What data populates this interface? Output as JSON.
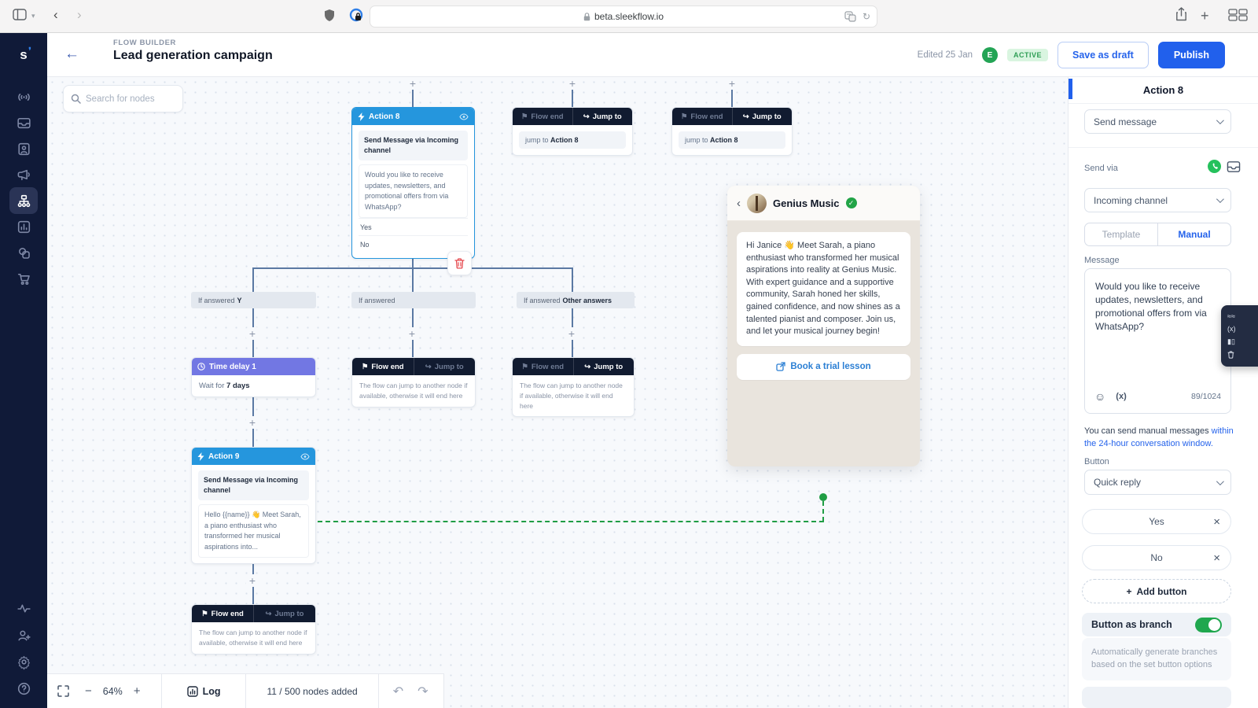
{
  "browser": {
    "url": "beta.sleekflow.io"
  },
  "header": {
    "eyebrow": "FLOW BUILDER",
    "title": "Lead generation campaign",
    "edited": "Edited 25 Jan",
    "avatar": "E",
    "status": "ACTIVE",
    "save_draft": "Save as draft",
    "publish": "Publish"
  },
  "sidebar": {
    "logo": "s",
    "icons": [
      "broadcast-icon",
      "inbox-icon",
      "contacts-icon",
      "campaigns-icon",
      "flow-builder-icon",
      "analytics-icon",
      "integrations-icon",
      "commerce-icon",
      "activity-icon",
      "invite-user-icon",
      "settings-icon",
      "help-icon"
    ]
  },
  "canvas": {
    "search_placeholder": "Search for nodes",
    "labels": {
      "flow_end": "Flow end",
      "jump_to": "Jump to",
      "end_body": "The flow can jump to another node if available, otherwise it will end here"
    },
    "action8": {
      "title": "Action 8",
      "subtitle": "Send Message via Incoming channel",
      "message": "Would you like to receive updates, newsletters, and promotional offers from via WhatsApp?",
      "option_yes": "Yes",
      "option_no": "No"
    },
    "jump_node": {
      "body_prefix": "jump to ",
      "body_target": "Action 8"
    },
    "branches": {
      "b1_prefix": "If answered",
      "b1_value": "Y",
      "b2_prefix": "If answered",
      "b3_prefix": "If answered",
      "b3_value": "Other answers"
    },
    "time_delay": {
      "title": "Time delay 1",
      "body_prefix": "Wait for ",
      "body_value": "7 days"
    },
    "action9": {
      "title": "Action 9",
      "subtitle": "Send Message via Incoming channel",
      "message": "Hello {{name}} 👋 Meet Sarah, a piano enthusiast who transformed her musical aspirations into..."
    },
    "preview": {
      "name": "Genius Music",
      "message": "Hi Janice 👋 Meet Sarah, a piano enthusiast who transformed her musical aspirations into reality at Genius Music. With expert guidance and a supportive community, Sarah honed her skills, gained confidence, and now shines as a talented pianist and composer. Join us, and let your musical journey begin!",
      "button": "Book a trial lesson"
    },
    "toolbar": {
      "zoom": "64%",
      "log": "Log",
      "count": "11 / 500 nodes added"
    }
  },
  "panel": {
    "title": "Action 8",
    "action_select": "Send message",
    "send_via_label": "Send via",
    "channel_select": "Incoming channel",
    "tab_template": "Template",
    "tab_manual": "Manual",
    "message_label": "Message",
    "message_value": "Would you like to receive updates, newsletters, and promotional offers from via WhatsApp?",
    "counter": "89/1024",
    "note_text": "You can send manual messages ",
    "note_link": "within the 24-hour conversation window.",
    "button_label": "Button",
    "button_type_select": "Quick reply",
    "btn_yes": "Yes",
    "btn_no": "No",
    "add_button": "Add button",
    "branch_title": "Button as branch",
    "branch_desc": "Automatically generate branches based on the set button options"
  },
  "colors": {
    "accent_blue": "#2160ec",
    "node_blue": "#2596dd",
    "delay_purple": "#7277e3",
    "dark_header": "#111b30",
    "green": "#1f9d44",
    "sidebar_navy": "#101a38",
    "status_green_bg": "#d9f5e0"
  }
}
